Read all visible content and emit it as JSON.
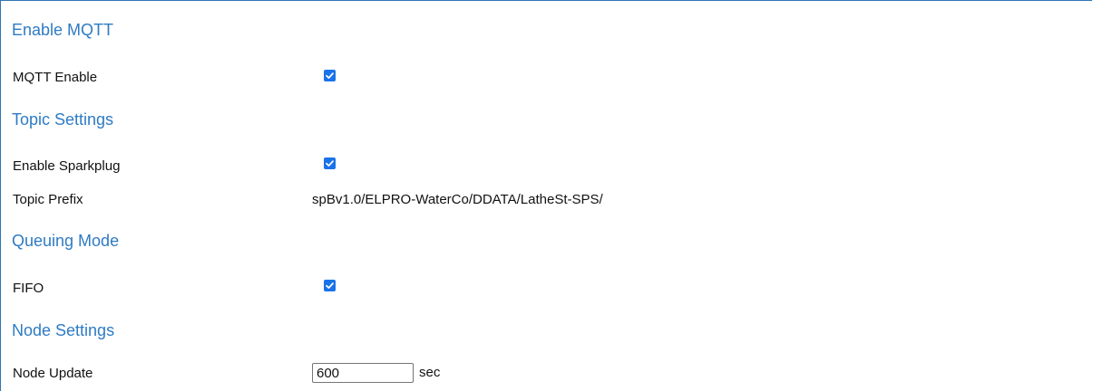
{
  "sections": {
    "enable_mqtt": {
      "title": "Enable MQTT",
      "mqtt_enable_label": "MQTT Enable",
      "mqtt_enable_checked": true
    },
    "topic_settings": {
      "title": "Topic Settings",
      "enable_sparkplug_label": "Enable Sparkplug",
      "enable_sparkplug_checked": true,
      "topic_prefix_label": "Topic Prefix",
      "topic_prefix_value": "spBv1.0/ELPRO-WaterCo/DDATA/LatheSt-SPS/"
    },
    "queuing_mode": {
      "title": "Queuing Mode",
      "fifo_label": "FIFO",
      "fifo_checked": true
    },
    "node_settings": {
      "title": "Node Settings",
      "node_update_label": "Node Update",
      "node_update_value": "600",
      "node_update_unit": "sec"
    }
  },
  "colors": {
    "section_title": "#2e7bc4",
    "checkbox_fill": "#1a73e8",
    "frame_border": "#2f75b5"
  },
  "icons": {
    "checkbox": "checkmark-icon"
  }
}
